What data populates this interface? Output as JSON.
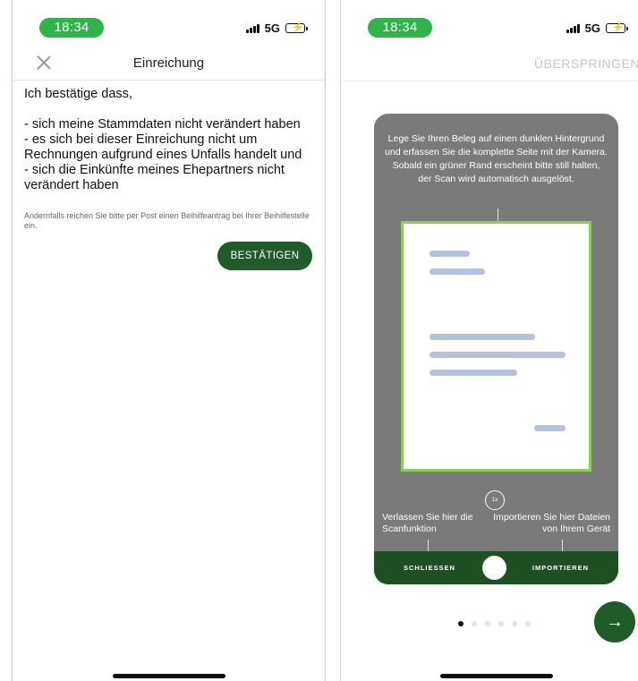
{
  "left_screen": {
    "status": {
      "time": "18:34",
      "network": "5G"
    },
    "nav": {
      "title": "Einreichung"
    },
    "confirm_heading": "Ich bestätige dass,",
    "confirm_items": [
      "- sich meine Stammdaten nicht verändert haben",
      "- es sich bei dieser Einreichung nicht um Rechnungen aufgrund eines Unfalls handelt und",
      "- sich die Einkünfte meines Ehepartners nicht verändert haben"
    ],
    "note": "Andernfalls reichen Sie bitte per Post einen Beihilfeantrag bei Ihrer Beihilfestelle ein.",
    "confirm_button": "BESTÄTIGEN"
  },
  "right_screen": {
    "status": {
      "time": "18:34",
      "network": "5G"
    },
    "skip_label": "ÜBERSPRINGEN",
    "scan_instructions": "Lege Sie Ihren Beleg auf einen dunklen Hintergrund und erfassen Sie die komplette Seite mit der Kamera. Sobald ein grüner Rand erscheint bitte still halten, der Scan wird automatisch ausgelöst.",
    "zoom_label": "1x",
    "callout_left": "Verlassen Sie hier die Scanfunktion",
    "callout_right": "Importieren Sie hier Dateien von Ihrem Gerät",
    "close_label": "SCHLIESSEN",
    "import_label": "IMPORTIEREN",
    "page_dots": {
      "count": 6,
      "active_index": 0
    }
  },
  "colors": {
    "time_pill": "#2fb34a",
    "primary_green": "#1f5c2a",
    "scan_frame_green": "#8ccc5a",
    "scan_overlay_gray": "#7a7a7a"
  },
  "icons": {
    "close": "close-icon",
    "next": "arrow-right-icon",
    "battery": "battery-charging-icon",
    "signal": "signal-icon"
  }
}
